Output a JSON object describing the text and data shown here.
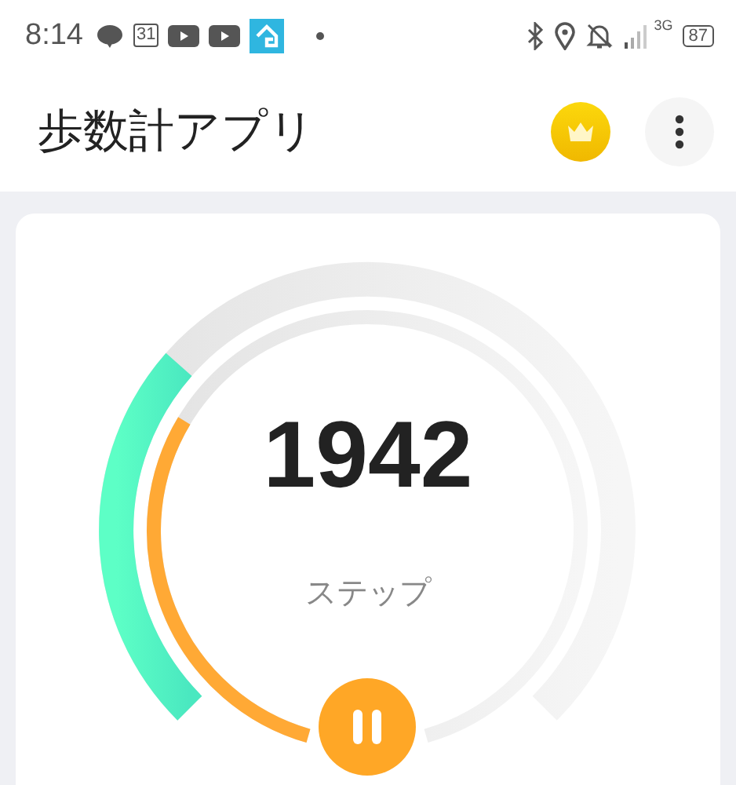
{
  "status_bar": {
    "time": "8:14",
    "calendar_day": "31",
    "network": "3G",
    "battery": "87"
  },
  "header": {
    "title": "歩数計アプリ"
  },
  "gauge": {
    "steps": "1942",
    "unit": "ステップ",
    "running": true
  }
}
